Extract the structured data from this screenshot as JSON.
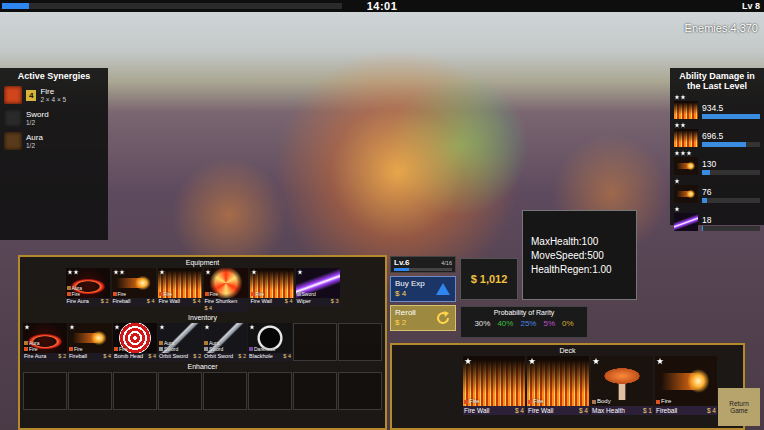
{
  "top_bar": {
    "progress": {
      "level": 0.08
    },
    "timer": "14:01",
    "level": "Lv 8"
  },
  "enemies": "Enemies:4,370",
  "synergies": {
    "title": "Active Synergies",
    "items": [
      {
        "name": "Fire",
        "count": "4",
        "detail": "2 × 4 × 5",
        "color": "#d0451b"
      },
      {
        "name": "Sword",
        "detail": "1/2",
        "color": "#2a2a2a"
      },
      {
        "name": "Aura",
        "detail": "1/2",
        "color": "#5a3a1a"
      }
    ]
  },
  "ability_damage": {
    "title": "Ability Damage in the Last Level",
    "rows": [
      {
        "stars": 2,
        "kind": "wall",
        "value": "934.5",
        "level": 1.0
      },
      {
        "stars": 2,
        "kind": "wall",
        "value": "696.5",
        "level": 0.75
      },
      {
        "stars": 3,
        "kind": "ball",
        "value": "130",
        "level": 0.14
      },
      {
        "stars": 1,
        "kind": "ball",
        "value": "76",
        "level": 0.08
      },
      {
        "stars": 1,
        "kind": "wiper",
        "value": "18",
        "level": 0.02
      }
    ]
  },
  "equipment": {
    "title": "Equipment",
    "cards": [
      {
        "name": "Fire Aura",
        "price": "$ 2",
        "stars": 2,
        "kind": "aura",
        "tags": [
          {
            "label": "Aura",
            "color": "#b07a30"
          },
          {
            "label": "Fire",
            "color": "#e0501c"
          }
        ]
      },
      {
        "name": "Fireball",
        "price": "$ 4",
        "stars": 2,
        "kind": "ball",
        "tags": [
          {
            "label": "Fire",
            "color": "#e0501c"
          }
        ]
      },
      {
        "name": "Fire Wall",
        "price": "$ 4",
        "stars": 1,
        "kind": "wall",
        "tags": [
          {
            "label": "Fire",
            "color": "#e0501c"
          }
        ]
      },
      {
        "name": "Fire Shuriken",
        "price": "$ 4",
        "stars": 1,
        "kind": "shuriken",
        "tags": [
          {
            "label": "Fire",
            "color": "#e0501c"
          }
        ]
      },
      {
        "name": "Fire Wall",
        "price": "$ 4",
        "stars": 1,
        "kind": "wall",
        "tags": [
          {
            "label": "Fire",
            "color": "#e0501c"
          }
        ]
      },
      {
        "name": "Wiper",
        "price": "$ 3",
        "stars": 1,
        "kind": "wiper",
        "tags": [
          {
            "label": "Sword",
            "color": "#9a9a9a"
          }
        ]
      }
    ]
  },
  "inventory": {
    "title": "Inventory",
    "cards": [
      {
        "name": "Fire Aura",
        "price": "$ 2",
        "stars": 1,
        "kind": "aura",
        "tags": [
          {
            "label": "Aura",
            "color": "#b07a30"
          },
          {
            "label": "Fire",
            "color": "#e0501c"
          }
        ]
      },
      {
        "name": "Fireball",
        "price": "$ 4",
        "stars": 1,
        "kind": "ball",
        "tags": [
          {
            "label": "Fire",
            "color": "#e0501c"
          }
        ]
      },
      {
        "name": "Bomb Head",
        "price": "$ 4",
        "stars": 1,
        "kind": "bomb",
        "tags": [
          {
            "label": "Fire",
            "color": "#e0501c"
          }
        ]
      },
      {
        "name": "Orbit Sword",
        "price": "$ 2",
        "stars": 1,
        "kind": "sword",
        "tags": [
          {
            "label": "Aura",
            "color": "#b07a30"
          },
          {
            "label": "Sword",
            "color": "#9a9a9a"
          }
        ]
      },
      {
        "name": "Orbit Sword",
        "price": "$ 2",
        "stars": 1,
        "kind": "sword",
        "tags": [
          {
            "label": "Aura",
            "color": "#b07a30"
          },
          {
            "label": "Sword",
            "color": "#9a9a9a"
          }
        ]
      },
      {
        "name": "Blackhole",
        "price": "$ 4",
        "stars": 1,
        "kind": "hole",
        "tags": [
          {
            "label": "Darkness",
            "color": "#7a4aa0"
          }
        ]
      },
      {
        "kind": "empty"
      },
      {
        "kind": "empty"
      }
    ]
  },
  "enhancer": {
    "title": "Enhancer",
    "slots": [
      {
        "kind": "empty"
      },
      {
        "kind": "empty"
      },
      {
        "kind": "empty"
      },
      {
        "kind": "empty"
      },
      {
        "kind": "empty"
      },
      {
        "kind": "empty"
      },
      {
        "kind": "empty"
      },
      {
        "kind": "empty"
      }
    ]
  },
  "level_box": {
    "label": "Lv.6",
    "exp": "4/16",
    "level": 0.25
  },
  "buy_exp": {
    "label": "Buy Exp",
    "price": "$ 4"
  },
  "money": "$ 1,012",
  "reroll": {
    "label": "Reroll",
    "price": "$ 2"
  },
  "stats": [
    "MaxHealth:100",
    "MoveSpeed:500",
    "HealthRegen:1.00"
  ],
  "rarity": {
    "title": "Probability of Rarity",
    "values": [
      {
        "text": "30%",
        "color": "#e0e0e0"
      },
      {
        "text": "40%",
        "color": "#3fbf3f"
      },
      {
        "text": "25%",
        "color": "#4a86e8"
      },
      {
        "text": "5%",
        "color": "#c050d0"
      },
      {
        "text": "0%",
        "color": "#d8b030"
      }
    ]
  },
  "deck": {
    "title": "Deck",
    "cards": [
      {
        "name": "Fire Wall",
        "price": "$ 4",
        "stars": 1,
        "kind": "wall",
        "tags": [
          {
            "label": "Fire",
            "color": "#e0501c"
          }
        ]
      },
      {
        "name": "Fire Wall",
        "price": "$ 4",
        "stars": 1,
        "kind": "wall",
        "tags": [
          {
            "label": "Fire",
            "color": "#e0501c"
          }
        ]
      },
      {
        "name": "Max Health",
        "price": "$ 1",
        "stars": 1,
        "kind": "body",
        "tags": [
          {
            "label": "Body",
            "color": "#b07850"
          }
        ]
      },
      {
        "name": "Fireball",
        "price": "$ 4",
        "stars": 1,
        "kind": "ball",
        "tags": [
          {
            "label": "Fire",
            "color": "#e0501c"
          }
        ]
      }
    ]
  },
  "return_button": "Return Game"
}
